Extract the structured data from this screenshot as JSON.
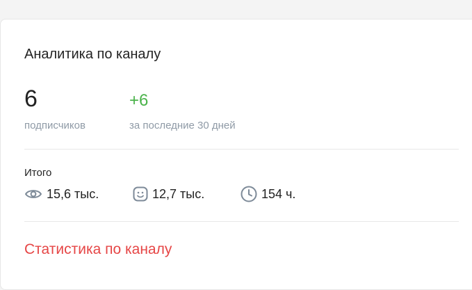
{
  "card": {
    "title": "Аналитика по каналу",
    "subscribers": {
      "value": "6",
      "caption": "подписчиков"
    },
    "growth": {
      "value": "+6",
      "caption": "за последние 30 дней"
    },
    "totals": {
      "label": "Итого",
      "metrics": [
        {
          "icon": "eye-icon",
          "value": "15,6 тыс."
        },
        {
          "icon": "smiley-icon",
          "value": "12,7 тыс."
        },
        {
          "icon": "clock-icon",
          "value": "154 ч."
        }
      ]
    },
    "link_label": "Статистика по каналу"
  },
  "colors": {
    "accent_green": "#4bb34b",
    "link_red": "#e64646",
    "muted_text": "#8f9aa6",
    "icon_gray": "#7d8a98"
  }
}
